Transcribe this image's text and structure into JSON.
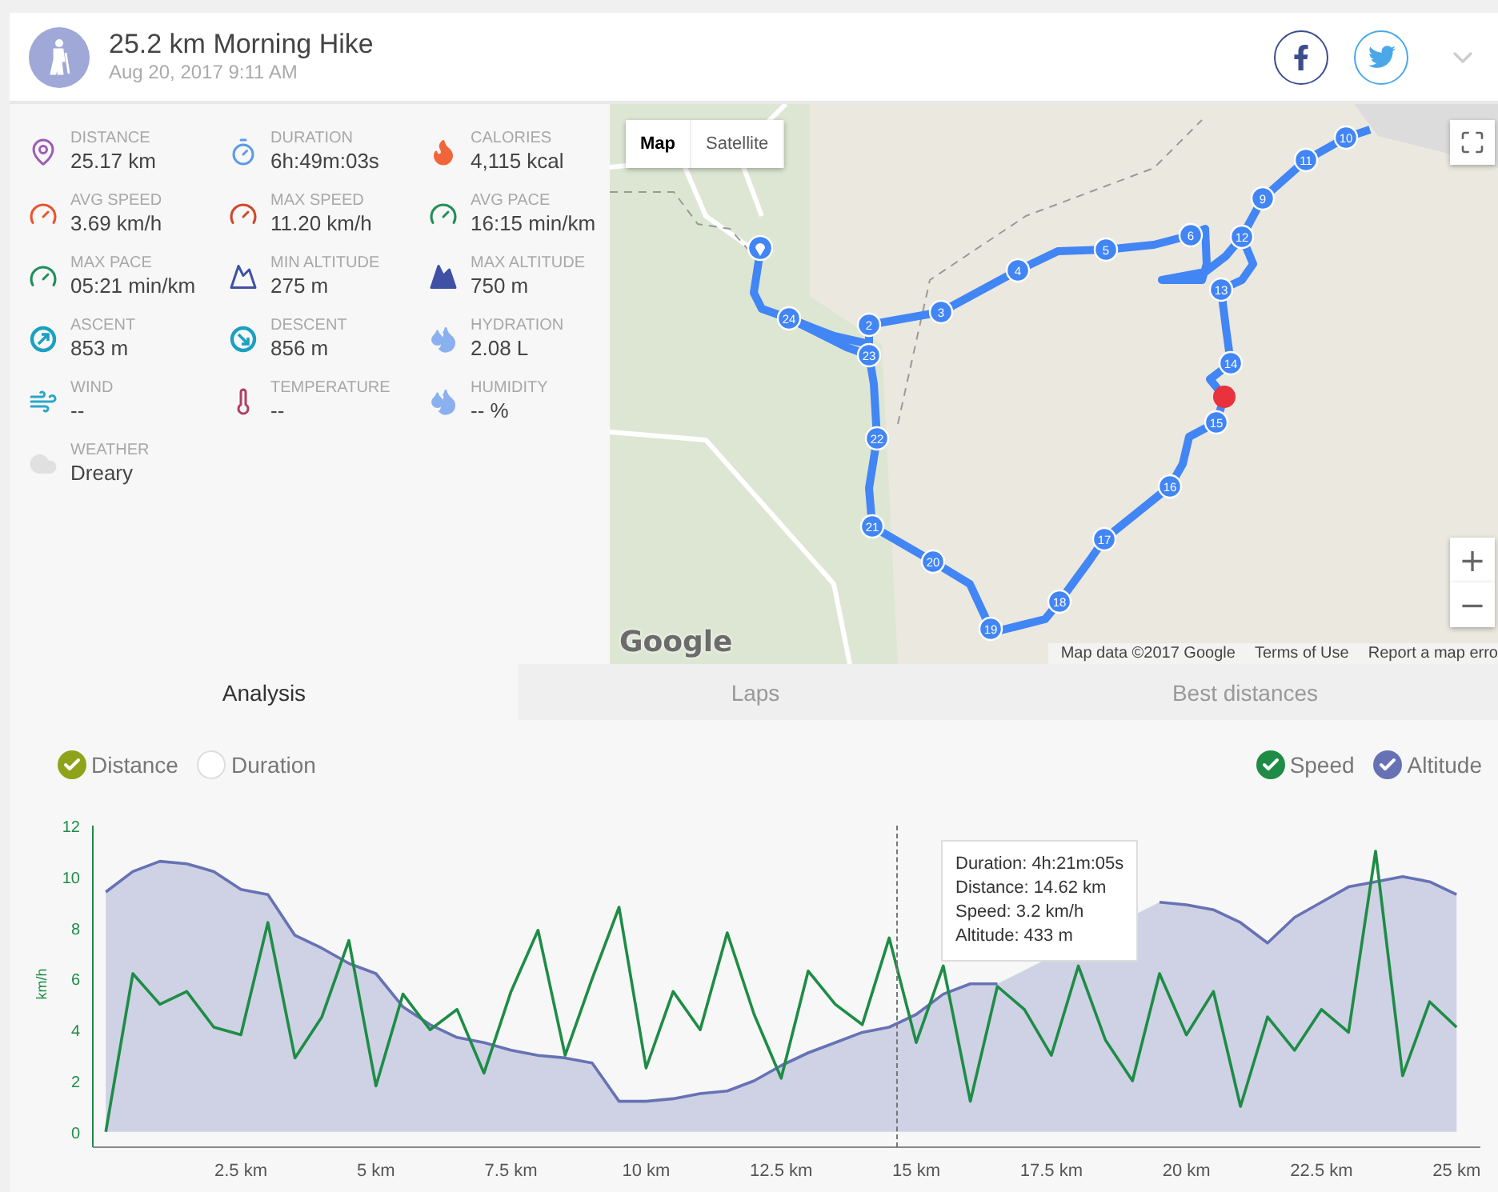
{
  "header": {
    "title": "25.2 km Morning Hike",
    "date": "Aug 20, 2017 9:11 AM"
  },
  "stats": [
    {
      "label": "DISTANCE",
      "value": "25.17 km"
    },
    {
      "label": "DURATION",
      "value": "6h:49m:03s"
    },
    {
      "label": "CALORIES",
      "value": "4,115 kcal"
    },
    {
      "label": "AVG SPEED",
      "value": "3.69 km/h"
    },
    {
      "label": "MAX SPEED",
      "value": "11.20 km/h"
    },
    {
      "label": "AVG PACE",
      "value": "16:15 min/km"
    },
    {
      "label": "MAX PACE",
      "value": "05:21 min/km"
    },
    {
      "label": "MIN ALTITUDE",
      "value": "275 m"
    },
    {
      "label": "MAX ALTITUDE",
      "value": "750 m"
    },
    {
      "label": "ASCENT",
      "value": "853 m"
    },
    {
      "label": "DESCENT",
      "value": "856 m"
    },
    {
      "label": "HYDRATION",
      "value": "2.08 L"
    },
    {
      "label": "WIND",
      "value": "--"
    },
    {
      "label": "TEMPERATURE",
      "value": "--"
    },
    {
      "label": "HUMIDITY",
      "value": "-- %"
    },
    {
      "label": "WEATHER",
      "value": "Dreary"
    }
  ],
  "map": {
    "types": [
      {
        "label": "Map",
        "selected": true
      },
      {
        "label": "Satellite",
        "selected": false
      }
    ],
    "markers": [
      "10",
      "11",
      "9",
      "6",
      "12",
      "5",
      "4",
      "13",
      "24",
      "2",
      "3",
      "23",
      "14",
      "15",
      "22",
      "16",
      "21",
      "17",
      "20",
      "18",
      "19"
    ],
    "logo": "Google",
    "attribution": "Map data ©2017 Google",
    "terms": "Terms of Use",
    "report": "Report a map erro",
    "zoom_in": "+",
    "zoom_out": "−"
  },
  "tabs": [
    {
      "label": "Analysis",
      "selected": true
    },
    {
      "label": "Laps",
      "selected": false
    },
    {
      "label": "Best distances",
      "selected": false
    }
  ],
  "axis_toggles": [
    {
      "label": "Distance",
      "selected": true
    },
    {
      "label": "Duration",
      "selected": false
    }
  ],
  "series_toggles": [
    {
      "checked": true
    },
    {
      "checked": true
    }
  ],
  "chart": {
    "chart_data": {
      "type": "line",
      "ylabel": "km/h",
      "xlim": [
        -0.24,
        25.44
      ],
      "ylim": [
        -0.6,
        12
      ],
      "yticks": [
        0,
        2,
        4,
        6,
        8,
        10,
        12
      ],
      "xticks": [
        {
          "value": 2.5,
          "label": "2.5 km"
        },
        {
          "value": 5,
          "label": "5 km"
        },
        {
          "value": 7.5,
          "label": "7.5 km"
        },
        {
          "value": 10,
          "label": "10 km"
        },
        {
          "value": 12.5,
          "label": "12.5 km"
        },
        {
          "value": 15,
          "label": "15 km"
        },
        {
          "value": 17.5,
          "label": "17.5 km"
        },
        {
          "value": 20,
          "label": "20 km"
        },
        {
          "value": 22.5,
          "label": "22.5 km"
        },
        {
          "value": 25,
          "label": "25 km"
        }
      ],
      "x": [
        0,
        0.5,
        1,
        1.5,
        2,
        2.5,
        3,
        3.5,
        4,
        4.5,
        5,
        5.5,
        6,
        6.5,
        7,
        7.5,
        8,
        8.5,
        9,
        9.5,
        10,
        10.5,
        11,
        11.5,
        12,
        12.5,
        13,
        13.5,
        14,
        14.5,
        15,
        15.5,
        16,
        16.5,
        17,
        17.5,
        18,
        18.5,
        19,
        19.5,
        20,
        20.5,
        21,
        21.5,
        22,
        22.5,
        23,
        23.5,
        24,
        24.5,
        25
      ],
      "series": [
        {
          "name": "Altitude",
          "type": "area",
          "color": "#6672b4",
          "values": [
            9.4,
            10.2,
            10.6,
            10.5,
            10.2,
            9.5,
            9.3,
            7.7,
            7.2,
            6.6,
            6.2,
            4.9,
            4.2,
            3.7,
            3.5,
            3.2,
            3.0,
            2.9,
            2.7,
            1.2,
            1.2,
            1.3,
            1.5,
            1.6,
            2.0,
            2.6,
            3.1,
            3.5,
            3.9,
            4.1,
            4.6,
            5.4,
            5.8,
            5.8,
            null,
            null,
            null,
            null,
            null,
            9.0,
            8.9,
            8.7,
            8.2,
            7.4,
            8.4,
            9.0,
            9.6,
            9.8,
            10.0,
            9.8,
            9.3
          ]
        },
        {
          "name": "Speed",
          "type": "line",
          "color": "#1e8c46",
          "values": [
            0,
            6.2,
            5.0,
            5.5,
            4.1,
            3.8,
            8.2,
            2.9,
            4.5,
            7.5,
            1.8,
            5.4,
            4.0,
            4.8,
            2.3,
            5.5,
            7.9,
            3.0,
            6.0,
            8.8,
            2.5,
            5.5,
            4.0,
            7.8,
            4.6,
            2.1,
            6.3,
            5.0,
            4.2,
            7.6,
            3.5,
            6.5,
            1.2,
            5.7,
            4.8,
            3.0,
            6.5,
            3.6,
            2.0,
            6.2,
            3.8,
            5.5,
            1.0,
            4.5,
            3.2,
            4.8,
            3.9,
            11.0,
            2.2,
            5.1,
            4.1
          ]
        }
      ]
    },
    "tooltip": [
      "Duration: 4h:21m:05s",
      "Distance: 14.62 km",
      "Speed: 3.2 km/h",
      "Altitude: 433 m"
    ]
  }
}
